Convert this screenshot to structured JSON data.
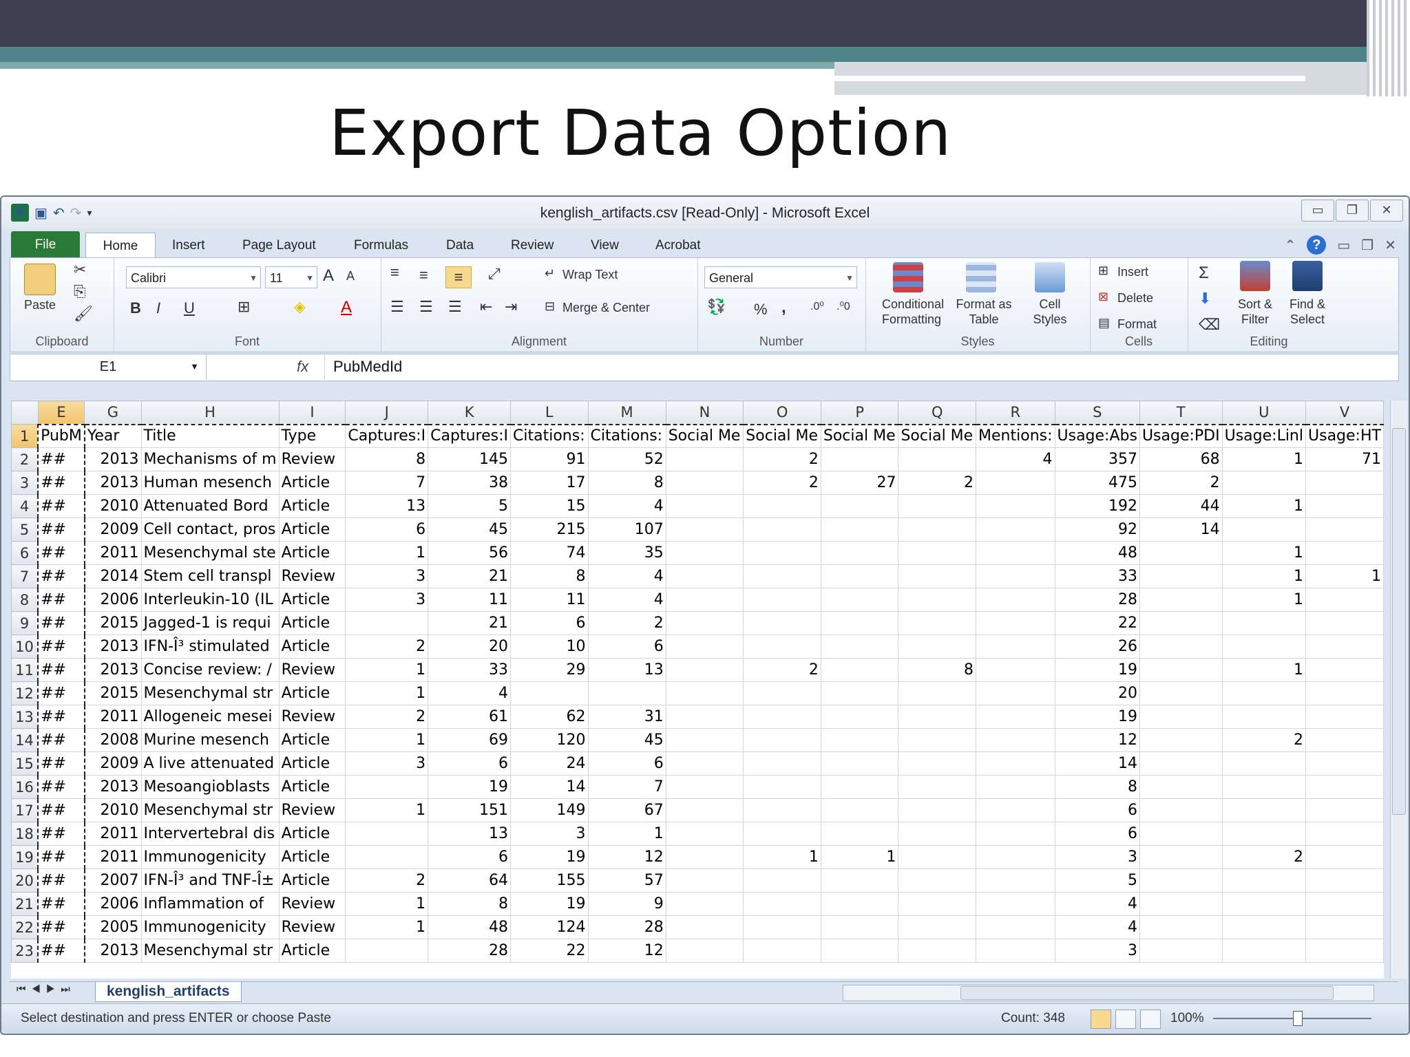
{
  "slide": {
    "title": "Export Data Option"
  },
  "window": {
    "title": "kenglish_artifacts.csv  [Read-Only]  -  Microsoft Excel",
    "colors": {
      "file_tab": "#2a7a37",
      "ribbon_border": "#a9bdd3",
      "selected_header": "#f2c46a"
    }
  },
  "tabs": [
    "File",
    "Home",
    "Insert",
    "Page Layout",
    "Formulas",
    "Data",
    "Review",
    "View",
    "Acrobat"
  ],
  "ribbon": {
    "clipboard": {
      "label": "Clipboard",
      "paste": "Paste"
    },
    "font": {
      "label": "Font",
      "name": "Calibri",
      "size": "11",
      "bold": "B",
      "italic": "I",
      "underline": "U",
      "grow": "A",
      "shrink": "A",
      "color_a": "A"
    },
    "alignment": {
      "label": "Alignment",
      "wrap": "Wrap Text",
      "merge": "Merge & Center"
    },
    "number": {
      "label": "Number",
      "format": "General",
      "percent": "%",
      "comma": ","
    },
    "styles": {
      "label": "Styles",
      "conditional": "Conditional Formatting",
      "format_table": "Format as Table",
      "cell_styles": "Cell Styles"
    },
    "cells": {
      "label": "Cells",
      "insert": "Insert",
      "delete": "Delete",
      "format": "Format"
    },
    "editing": {
      "label": "Editing",
      "sigma": "Σ",
      "sort": "Sort & Filter",
      "find": "Find & Select"
    }
  },
  "formula_bar": {
    "name_box": "E1",
    "fx": "fx",
    "value": "PubMedId"
  },
  "columns": [
    "E",
    "G",
    "H",
    "I",
    "J",
    "K",
    "L",
    "M",
    "N",
    "O",
    "P",
    "Q",
    "R",
    "S",
    "T",
    "U",
    "V"
  ],
  "header_row": [
    "PubM",
    "Year",
    "Title",
    "Type",
    "Captures:I",
    "Captures:I",
    "Citations:",
    "Citations:",
    "Social Me",
    "Social Me",
    "Social Me",
    "Social Me",
    "Mentions:",
    "Usage:Abs",
    "Usage:PDI",
    "Usage:Linl",
    "Usage:HT"
  ],
  "rows": [
    [
      "##",
      "2013",
      "Mechanisms of m",
      "Review",
      "8",
      "145",
      "91",
      "52",
      "",
      "2",
      "",
      "",
      "4",
      "357",
      "68",
      "1",
      "71"
    ],
    [
      "##",
      "2013",
      "Human mesench",
      "Article",
      "7",
      "38",
      "17",
      "8",
      "",
      "2",
      "27",
      "2",
      "",
      "475",
      "2",
      "",
      ""
    ],
    [
      "##",
      "2010",
      "Attenuated Bord",
      "Article",
      "13",
      "5",
      "15",
      "4",
      "",
      "",
      "",
      "",
      "",
      "192",
      "44",
      "1",
      ""
    ],
    [
      "##",
      "2009",
      "Cell contact, pros",
      "Article",
      "6",
      "45",
      "215",
      "107",
      "",
      "",
      "",
      "",
      "",
      "92",
      "14",
      "",
      ""
    ],
    [
      "##",
      "2011",
      "Mesenchymal ste",
      "Article",
      "1",
      "56",
      "74",
      "35",
      "",
      "",
      "",
      "",
      "",
      "48",
      "",
      "1",
      ""
    ],
    [
      "##",
      "2014",
      "Stem cell transpl",
      "Review",
      "3",
      "21",
      "8",
      "4",
      "",
      "",
      "",
      "",
      "",
      "33",
      "",
      "1",
      "1"
    ],
    [
      "##",
      "2006",
      "Interleukin-10 (IL",
      "Article",
      "3",
      "11",
      "11",
      "4",
      "",
      "",
      "",
      "",
      "",
      "28",
      "",
      "1",
      ""
    ],
    [
      "##",
      "2015",
      "Jagged-1 is requi",
      "Article",
      "",
      "21",
      "6",
      "2",
      "",
      "",
      "",
      "",
      "",
      "22",
      "",
      "",
      ""
    ],
    [
      "##",
      "2013",
      "IFN-Î³ stimulated",
      "Article",
      "2",
      "20",
      "10",
      "6",
      "",
      "",
      "",
      "",
      "",
      "26",
      "",
      "",
      ""
    ],
    [
      "##",
      "2013",
      "Concise review: /",
      "Review",
      "1",
      "33",
      "29",
      "13",
      "",
      "2",
      "",
      "8",
      "",
      "19",
      "",
      "1",
      ""
    ],
    [
      "##",
      "2015",
      "Mesenchymal str",
      "Article",
      "1",
      "4",
      "",
      "",
      "",
      "",
      "",
      "",
      "",
      "20",
      "",
      "",
      ""
    ],
    [
      "##",
      "2011",
      "Allogeneic mesei",
      "Review",
      "2",
      "61",
      "62",
      "31",
      "",
      "",
      "",
      "",
      "",
      "19",
      "",
      "",
      ""
    ],
    [
      "##",
      "2008",
      "Murine mesench",
      "Article",
      "1",
      "69",
      "120",
      "45",
      "",
      "",
      "",
      "",
      "",
      "12",
      "",
      "2",
      ""
    ],
    [
      "##",
      "2009",
      "A live attenuated",
      "Article",
      "3",
      "6",
      "24",
      "6",
      "",
      "",
      "",
      "",
      "",
      "14",
      "",
      "",
      ""
    ],
    [
      "##",
      "2013",
      "Mesoangioblasts",
      "Article",
      "",
      "19",
      "14",
      "7",
      "",
      "",
      "",
      "",
      "",
      "8",
      "",
      "",
      ""
    ],
    [
      "##",
      "2010",
      "Mesenchymal str",
      "Review",
      "1",
      "151",
      "149",
      "67",
      "",
      "",
      "",
      "",
      "",
      "6",
      "",
      "",
      ""
    ],
    [
      "##",
      "2011",
      "Intervertebral dis",
      "Article",
      "",
      "13",
      "3",
      "1",
      "",
      "",
      "",
      "",
      "",
      "6",
      "",
      "",
      ""
    ],
    [
      "##",
      "2011",
      "Immunogenicity",
      "Article",
      "",
      "6",
      "19",
      "12",
      "",
      "1",
      "1",
      "",
      "",
      "3",
      "",
      "2",
      ""
    ],
    [
      "##",
      "2007",
      "IFN-Î³ and TNF-Î±",
      "Article",
      "2",
      "64",
      "155",
      "57",
      "",
      "",
      "",
      "",
      "",
      "5",
      "",
      "",
      ""
    ],
    [
      "##",
      "2006",
      "Inflammation of",
      "Review",
      "1",
      "8",
      "19",
      "9",
      "",
      "",
      "",
      "",
      "",
      "4",
      "",
      "",
      ""
    ],
    [
      "##",
      "2005",
      "Immunogenicity",
      "Review",
      "1",
      "48",
      "124",
      "28",
      "",
      "",
      "",
      "",
      "",
      "4",
      "",
      "",
      ""
    ],
    [
      "##",
      "2013",
      "Mesenchymal str",
      "Article",
      "",
      "28",
      "22",
      "12",
      "",
      "",
      "",
      "",
      "",
      "3",
      "",
      "",
      ""
    ]
  ],
  "sheet_tab": "kenglish_artifacts",
  "status": {
    "message": "Select destination and press ENTER or choose Paste",
    "count": "Count: 348",
    "zoom": "100%"
  }
}
